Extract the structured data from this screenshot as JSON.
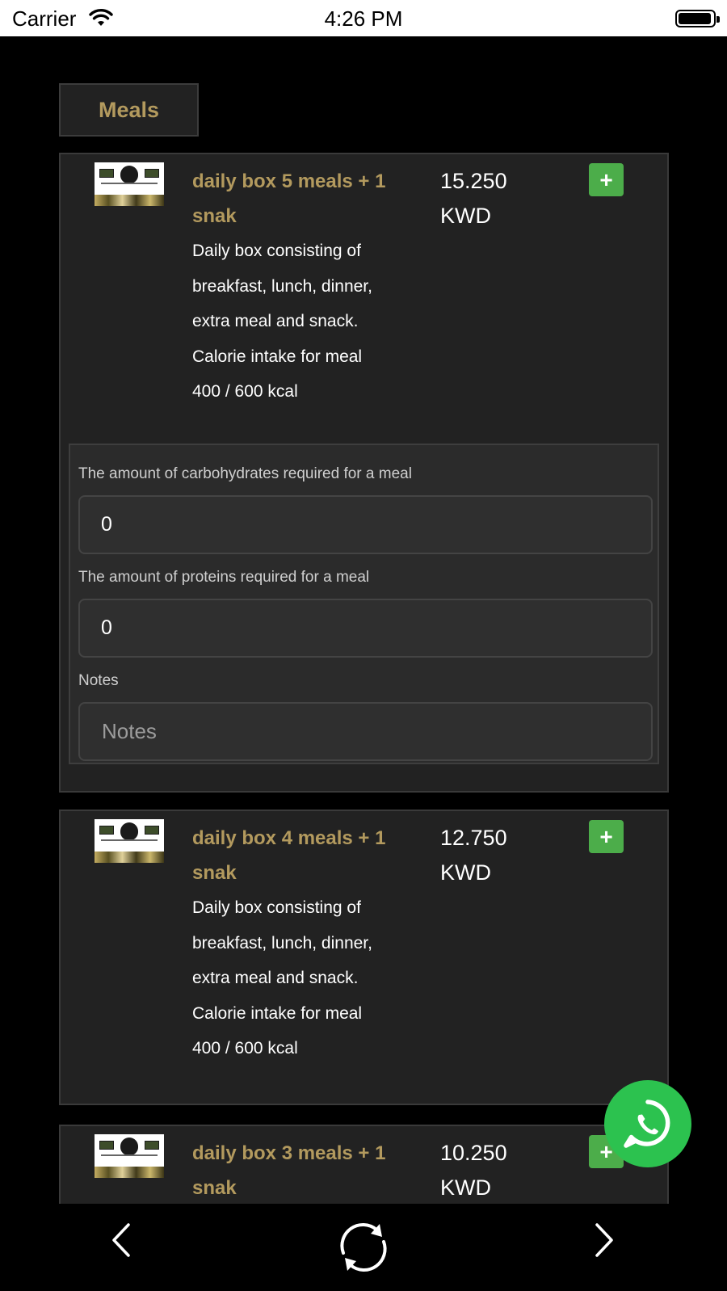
{
  "status_bar": {
    "carrier": "Carrier",
    "time": "4:26 PM"
  },
  "tab": {
    "label": "Meals"
  },
  "meals": [
    {
      "title": "daily box 5 meals + 1 snak",
      "description": "Daily box consisting of breakfast, lunch, dinner, extra meal and snack. Calorie intake for meal 400 / 600 kcal",
      "price": "15.250",
      "currency": "KWD",
      "add_icon": "+",
      "options": {
        "carbs_label": "The amount of carbohydrates required for a meal",
        "carbs_value": "0",
        "protein_label": "The amount of proteins required for a meal",
        "protein_value": "0",
        "notes_label": "Notes",
        "notes_placeholder": "Notes"
      }
    },
    {
      "title": "daily box 4 meals + 1 snak",
      "description": "Daily box consisting of breakfast, lunch, dinner, extra meal and snack. Calorie intake for meal 400 / 600 kcal",
      "price": "12.750",
      "currency": "KWD",
      "add_icon": "+"
    },
    {
      "title": "daily box 3 meals + 1 snak",
      "price": "10.250",
      "currency": "KWD",
      "add_icon": "+"
    }
  ],
  "colors": {
    "accent_gold": "#b39a5e",
    "add_green": "#4cad4a",
    "whatsapp_green": "#2cc24f",
    "card_bg": "#222222"
  },
  "icons": {
    "whatsapp": "whatsapp-icon",
    "back": "chevron-left-icon",
    "refresh": "refresh-icon",
    "forward": "chevron-right-icon",
    "wifi": "wifi-icon",
    "battery": "battery-icon"
  }
}
